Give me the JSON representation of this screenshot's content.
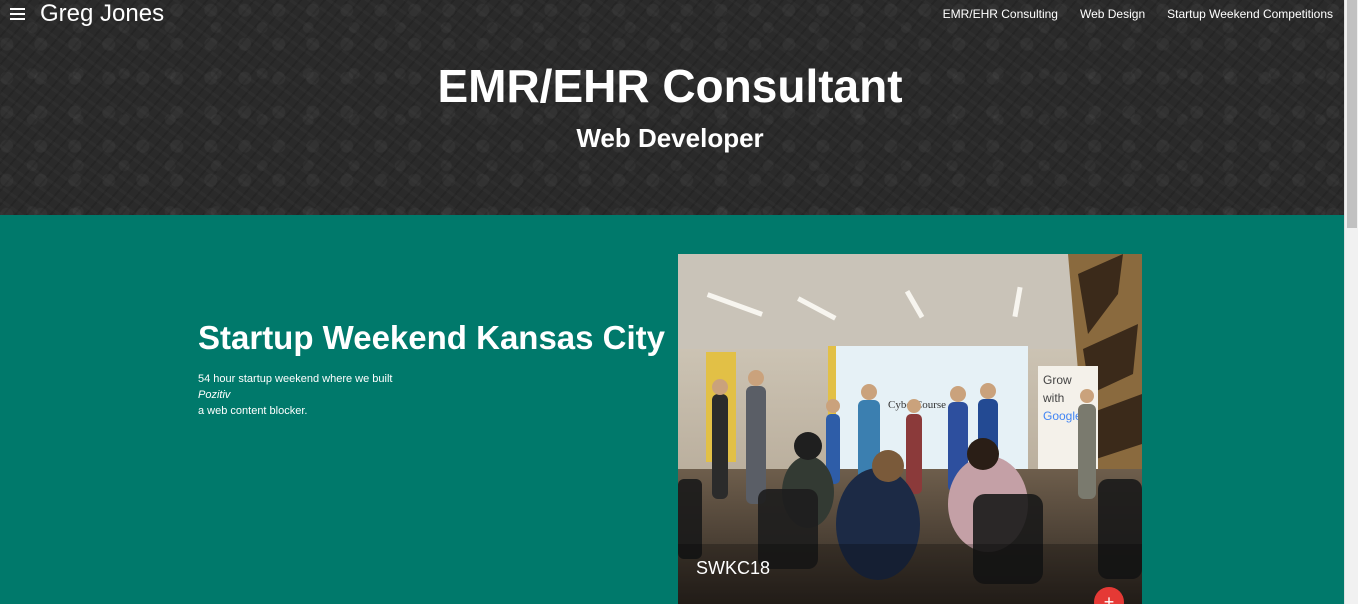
{
  "header": {
    "site_title": "Greg Jones",
    "menu_icon": "hamburger-menu-icon",
    "nav": [
      {
        "label": "EMR/EHR Consulting"
      },
      {
        "label": "Web Design"
      },
      {
        "label": "Startup Weekend Competitions"
      }
    ],
    "title": "EMR/EHR Consultant",
    "subtitle": "Web Developer"
  },
  "feature": {
    "title": "Startup Weekend Kansas City",
    "desc_line1": "54 hour startup weekend where we built",
    "desc_product": "Pozitiv",
    "desc_line3": "a web content blocker.",
    "card_caption": "SWKC18",
    "fab_label": "+",
    "photo_sign_text": "Grow with Google",
    "photo_screen_text": "CyberCourse"
  },
  "colors": {
    "header_bg": "#2a2a2a",
    "feature_bg": "#00796b",
    "fab": "#e53935"
  }
}
